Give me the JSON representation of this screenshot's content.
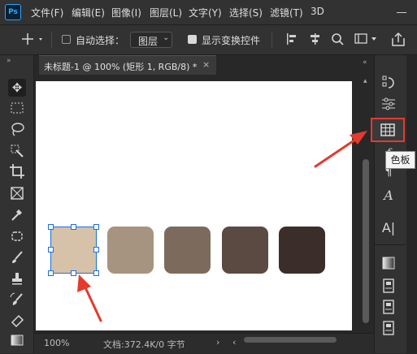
{
  "app": {
    "logo": "Ps"
  },
  "menu": {
    "items": [
      "文件(F)",
      "编辑(E)",
      "图像(I)",
      "图层(L)",
      "文字(Y)",
      "选择(S)",
      "滤镜(T)",
      "3D"
    ]
  },
  "options": {
    "auto_select_label": "自动选择：",
    "auto_select_checked": false,
    "layer_select_value": "图层",
    "show_transform_label": "显示变换控件",
    "show_transform_checked": true
  },
  "document": {
    "tab_title": "未标题-1 @ 100% (矩形 1, RGB/8) *",
    "tab_close": "×",
    "zoom": "100%",
    "doc_info": "文档:372.4K/0 字节"
  },
  "swatches": [
    {
      "color": "#d5c2a8",
      "selected": true
    },
    {
      "color": "#a69480"
    },
    {
      "color": "#7c6b5d"
    },
    {
      "color": "#5b4a41"
    },
    {
      "color": "#3b2e2a"
    }
  ],
  "right_panel": {
    "tooltip": "色板",
    "icons": [
      "history-icon",
      "adjustments-icon",
      "swatches-icon",
      "paragraph-icon",
      "character-icon",
      "character-style-icon",
      "gradients-icon",
      "libraries-icon",
      "layers-icon",
      "channels-icon"
    ]
  },
  "toolbar": {
    "icons": [
      "move-tool-icon",
      "marquee-tool-icon",
      "lasso-tool-icon",
      "quick-select-tool-icon",
      "crop-tool-icon",
      "frame-tool-icon",
      "eyedropper-tool-icon",
      "healing-brush-tool-icon",
      "brush-tool-icon",
      "stamp-tool-icon",
      "history-brush-tool-icon",
      "eraser-tool-icon",
      "gradient-tool-icon"
    ]
  },
  "colors": {
    "accent": "#1a6fe3",
    "annotation": "#e33b2e",
    "tooltip_bg": "#f4f4f4"
  }
}
